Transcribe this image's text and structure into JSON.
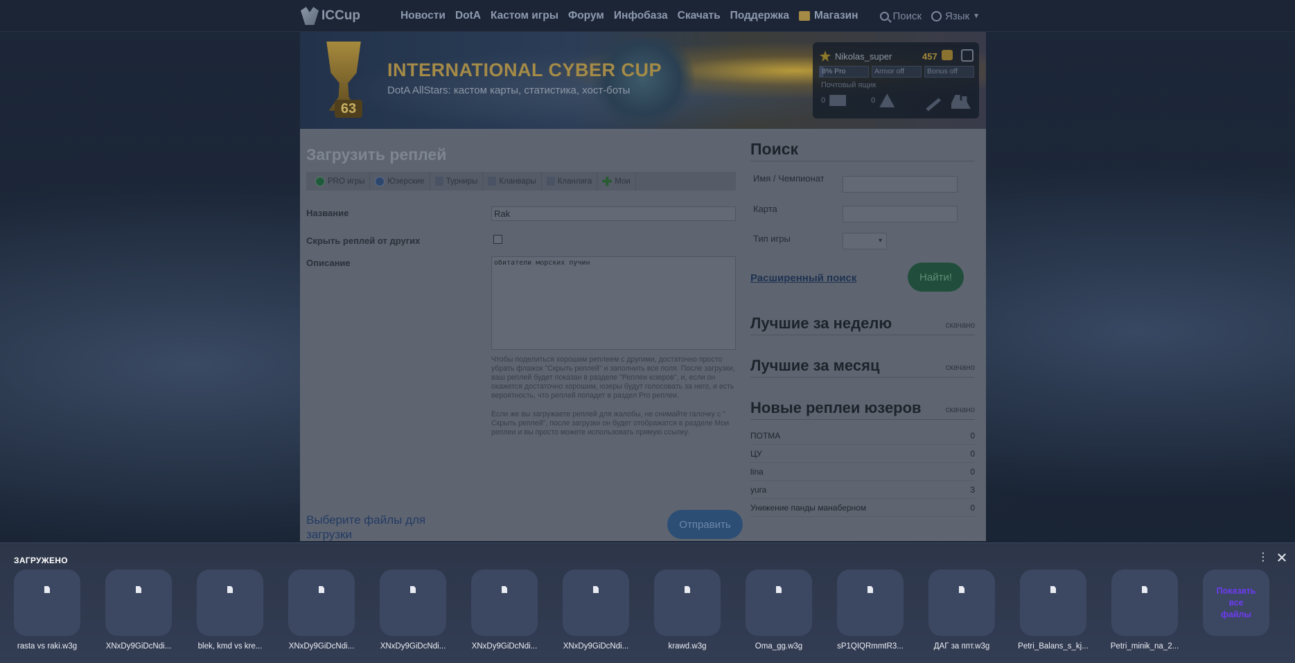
{
  "nav": {
    "logo": "ICCup",
    "items": [
      "Новости",
      "DotA",
      "Кастом игры",
      "Форум",
      "Инфобаза",
      "Скачать",
      "Поддержка"
    ],
    "shop": "Магазин",
    "search": "Поиск",
    "language": "Язык"
  },
  "banner": {
    "title": "INTERNATIONAL CYBER CUP",
    "subtitle": "DotA AllStars: кастом карты, статистика, хост-боты",
    "trophy_number": "63"
  },
  "user": {
    "name": "Nikolas_super",
    "gold": "457",
    "pro": "8% Pro",
    "pro_fraction": 0.08,
    "armor": "Armor off",
    "bonus": "Bonus off",
    "mailbox_label": "Почтовый ящик",
    "mail_count": "0",
    "warn_count": "0"
  },
  "upload": {
    "title": "Загрузить реплей",
    "tabs": [
      "PRO игры",
      "Юзерские",
      "Турниры",
      "Кланвары",
      "Кланлига",
      "Мои"
    ],
    "name_label": "Название",
    "name_value": "Rak",
    "hide_label": "Скрыть реплей от других",
    "desc_label": "Описание",
    "desc_value": "обитатели морских пучин",
    "hint1": "Чтобы поделиться хорошим реплеем с другими, достаточно просто убрать флажок \"Скрыть реплей\" и заполнить все поля. После загрузки, ваш реплей будет показан в разделе \"Реплеи юзеров\", и, если он окажется достаточно хорошим, юзеры будут голосовать за него, и есть вероятность, что реплей попадет в раздел Pro реплеи.",
    "hint2": "Если же вы загружаете реплей для жалобы, не снимайте галочку с \" Скрыть реплей\", после загрузки он будет отображатся в разделе Мои реплеи и вы просто можете использовать прямую ссылку.",
    "choose": "Выберите файлы для загрузки",
    "send": "Отправить"
  },
  "search": {
    "title": "Поиск",
    "name_label": "Имя / Чемпионат",
    "map_label": "Карта",
    "type_label": "Тип игры",
    "advanced": "Расширенный поиск",
    "find": "Найти!"
  },
  "sections": {
    "week": "Лучшие за неделю",
    "month": "Лучшие за месяц",
    "new": "Новые реплеи юзеров",
    "downloaded": "скачано"
  },
  "new_replays": [
    {
      "name": "ПОТМА",
      "count": "0"
    },
    {
      "name": "ЦУ",
      "count": "0"
    },
    {
      "name": "lina",
      "count": "0"
    },
    {
      "name": "yura",
      "count": "3"
    },
    {
      "name": "Унижение панды манаберном",
      "count": "0"
    }
  ],
  "downloads": {
    "title": "ЗАГРУЖЕНО",
    "files": [
      "rasta vs raki.w3g",
      "XNxDy9GiDcNdi...",
      "blek, kmd vs kre...",
      "XNxDy9GiDcNdi...",
      "XNxDy9GiDcNdi...",
      "XNxDy9GiDcNdi...",
      "XNxDy9GiDcNdi...",
      "krawd.w3g",
      "Oma_gg.w3g",
      "sP1QIQRmmtR3...",
      "ДАГ за ппт.w3g",
      "Petri_Balans_s_kj...",
      "Petri_minik_na_2..."
    ],
    "show_all": "Показать все файлы"
  },
  "icons": [
    "search-icon",
    "globe-icon",
    "shop-icon",
    "star-icon",
    "coins-icon",
    "logout-icon",
    "mail-icon",
    "warning-icon",
    "wrench-icon",
    "users-icon",
    "more-icon",
    "close-icon",
    "file-icon"
  ]
}
